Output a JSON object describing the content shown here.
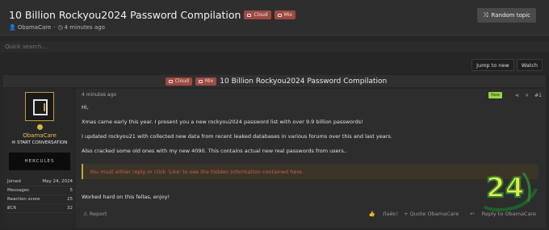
{
  "header": {
    "title": "10 Billion Rockyou2024 Password Compilation",
    "tags": [
      "Cloud",
      "Mix"
    ],
    "author": "ObamaCare",
    "separator": "·",
    "time": "4 minutes ago",
    "random_button": "Random topic"
  },
  "search": {
    "placeholder": "Quick search..."
  },
  "actions": {
    "jump": "Jump to new",
    "watch": "Watch"
  },
  "thread_bar": {
    "tags": [
      "Cloud",
      "Mix"
    ],
    "title": "10 Billion Rockyou2024 Password Compilation"
  },
  "user": {
    "name": "ObamaCare",
    "start_conversation": "START CONVERSATION",
    "banner_text": "HERCULES",
    "stats": [
      {
        "label": "Joined",
        "value": "May 24, 2024"
      },
      {
        "label": "Messages",
        "value": "5"
      },
      {
        "label": "Reaction score",
        "value": "25"
      },
      {
        "label": "₽CR",
        "value": "32"
      }
    ]
  },
  "post": {
    "time": "4 minutes ago",
    "new_badge": "New",
    "number": "#1",
    "paragraphs": [
      "Hi,",
      "Xmas came early this year. I present you a new rockyou2024 password list with over 9.9 billion passwords!",
      "I updated rockyou21 with collected new data from recent leaked databases in various forums over this and last years.",
      "Also cracked some old ones with my new 4090. This contains actual new real passwords from users.."
    ],
    "hidden_notice": "You must either reply or click 'Like' to see the hidden information contained here.",
    "closing": "Worked hard on this fellas, enjoy!",
    "report": "Report",
    "like": "Лайк!",
    "quote": "+ Quote ObamaCare",
    "reply": "Reply to ObamaCare"
  },
  "colors": {
    "accent": "#c9a33c",
    "tag": "#9c4b42",
    "notice": "#cf5a5a",
    "new": "#9bd445"
  }
}
